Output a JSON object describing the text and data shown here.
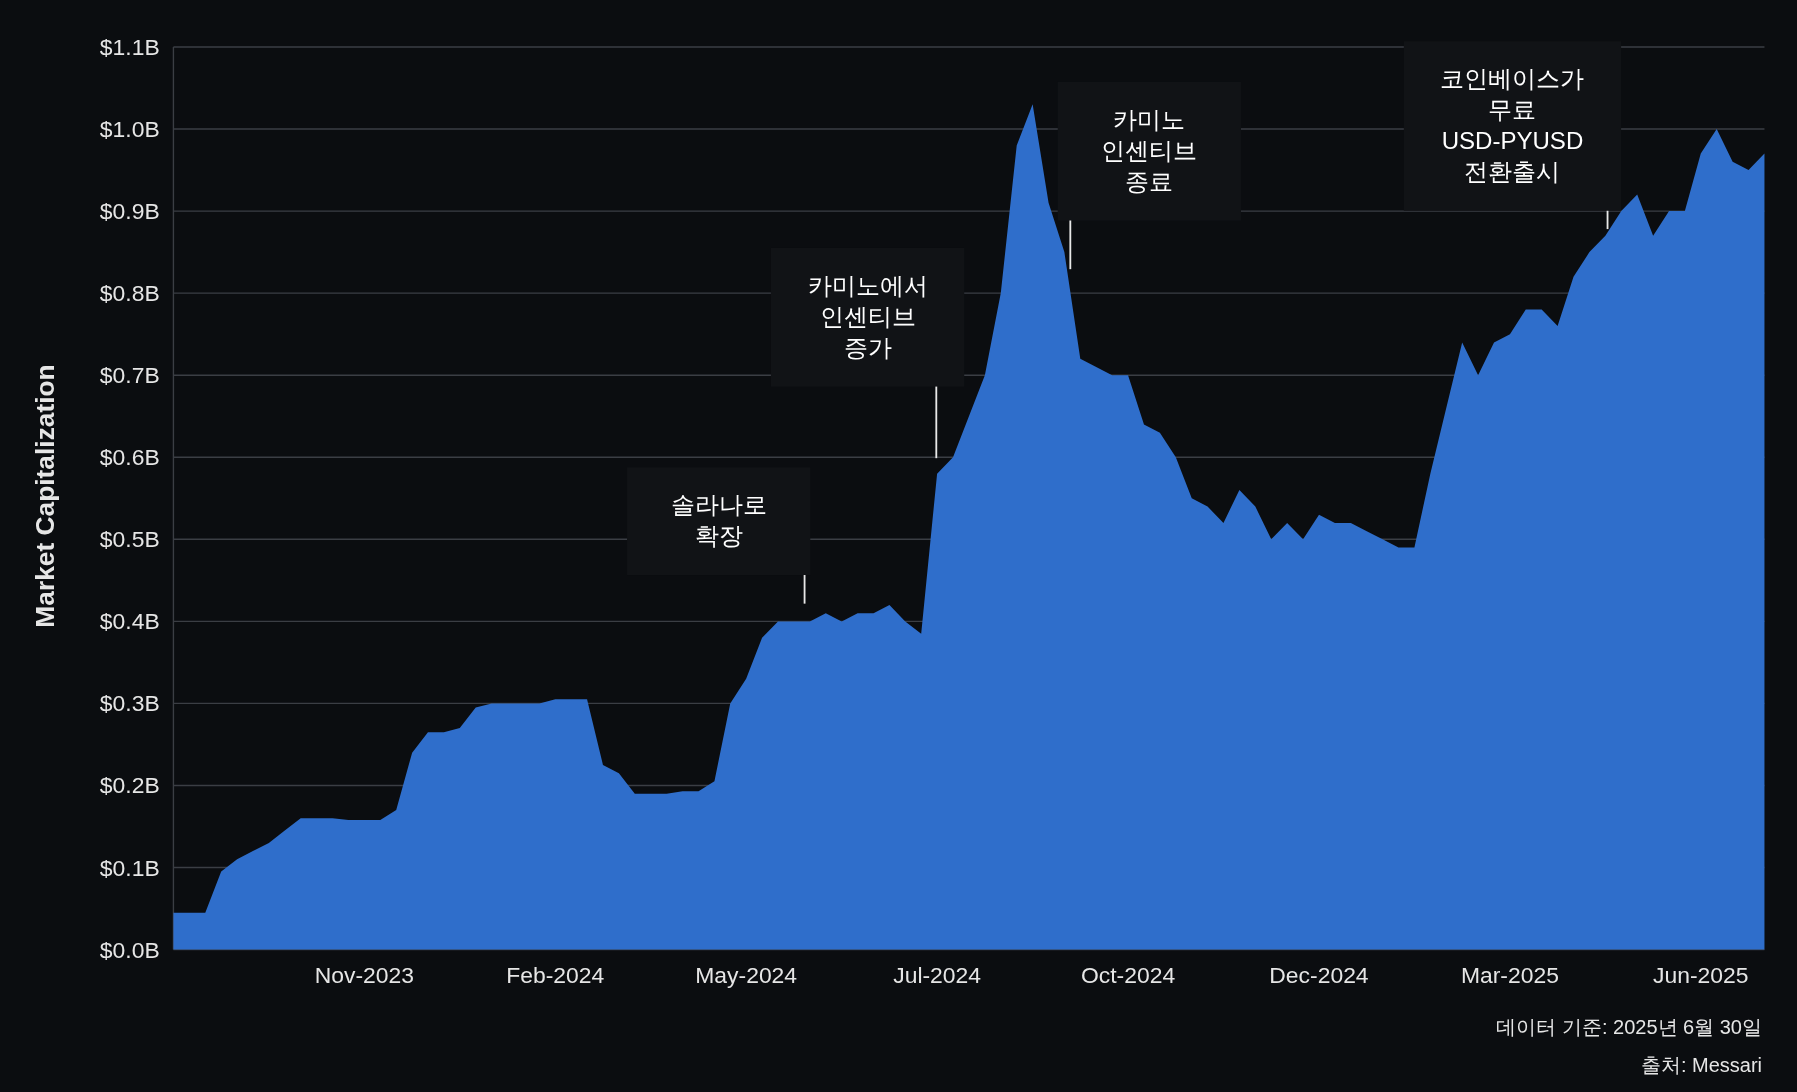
{
  "chart": {
    "chart_data": {
      "type": "area",
      "ylabel": "Market Capitalization",
      "categories": [
        null,
        null,
        null,
        null,
        null,
        null,
        null,
        null,
        null,
        null,
        null,
        null,
        "Nov-2023",
        null,
        null,
        null,
        null,
        null,
        null,
        null,
        null,
        null,
        null,
        null,
        "Feb-2024",
        null,
        null,
        null,
        null,
        null,
        null,
        null,
        null,
        null,
        null,
        null,
        "May-2024",
        null,
        null,
        null,
        null,
        null,
        null,
        null,
        null,
        null,
        null,
        null,
        "Jul-2024",
        null,
        null,
        null,
        null,
        null,
        null,
        null,
        null,
        null,
        null,
        null,
        "Oct-2024",
        null,
        null,
        null,
        null,
        null,
        null,
        null,
        null,
        null,
        null,
        null,
        "Dec-2024",
        null,
        null,
        null,
        null,
        null,
        null,
        null,
        null,
        null,
        null,
        null,
        "Mar-2025",
        null,
        null,
        null,
        null,
        null,
        null,
        null,
        null,
        null,
        null,
        null,
        "Jun-2025",
        null,
        null,
        null,
        null
      ],
      "series": [
        {
          "color": "#2f6ecb",
          "values": [
            0.045,
            0.045,
            0.045,
            0.095,
            0.11,
            0.12,
            0.13,
            0.145,
            0.16,
            0.16,
            0.16,
            0.158,
            0.158,
            0.158,
            0.17,
            0.24,
            0.265,
            0.265,
            0.27,
            0.295,
            0.3,
            0.3,
            0.3,
            0.3,
            0.305,
            0.305,
            0.305,
            0.225,
            0.215,
            0.19,
            0.19,
            0.19,
            0.193,
            0.193,
            0.205,
            0.3,
            0.33,
            0.38,
            0.4,
            0.4,
            0.4,
            0.41,
            0.4,
            0.41,
            0.41,
            0.42,
            0.4,
            0.385,
            0.58,
            0.6,
            0.65,
            0.7,
            0.8,
            0.98,
            1.03,
            0.91,
            0.85,
            0.72,
            0.71,
            0.7,
            0.7,
            0.64,
            0.63,
            0.6,
            0.55,
            0.54,
            0.52,
            0.56,
            0.54,
            0.5,
            0.52,
            0.5,
            0.53,
            0.52,
            0.52,
            0.51,
            0.5,
            0.49,
            0.49,
            0.58,
            0.66,
            0.74,
            0.7,
            0.74,
            0.75,
            0.78,
            0.78,
            0.76,
            0.82,
            0.85,
            0.87,
            0.9,
            0.92,
            0.87,
            0.9,
            0.9,
            0.97,
            1.0,
            0.96,
            0.95,
            0.97
          ]
        }
      ],
      "ylim": [
        0,
        1.1
      ],
      "yticks": [
        {
          "value": 0,
          "label": "$0.0B"
        },
        {
          "value": 0.1,
          "label": "$0.1B"
        },
        {
          "value": 0.2,
          "label": "$0.2B"
        },
        {
          "value": 0.3,
          "label": "$0.3B"
        },
        {
          "value": 0.4,
          "label": "$0.4B"
        },
        {
          "value": 0.5,
          "label": "$0.5B"
        },
        {
          "value": 0.6,
          "label": "$0.6B"
        },
        {
          "value": 0.7,
          "label": "$0.7B"
        },
        {
          "value": 0.8,
          "label": "$0.8B"
        },
        {
          "value": 0.9,
          "label": "$0.9B"
        },
        {
          "value": 1.0,
          "label": "$1.0B"
        },
        {
          "value": 1.1,
          "label": "$1.1B"
        }
      ],
      "grid": true,
      "annotations": [
        "솔라나로\n확장",
        "카미노에서\n인센티브\n증가",
        "카미노\n인센티브\n종료",
        "코인베이스가\n무료\nUSD-PYUSD\n전환출시"
      ]
    }
  },
  "footer": {
    "data_date": "데이터 기준: 2025년 6월 30일",
    "source": "출처: Messari"
  }
}
